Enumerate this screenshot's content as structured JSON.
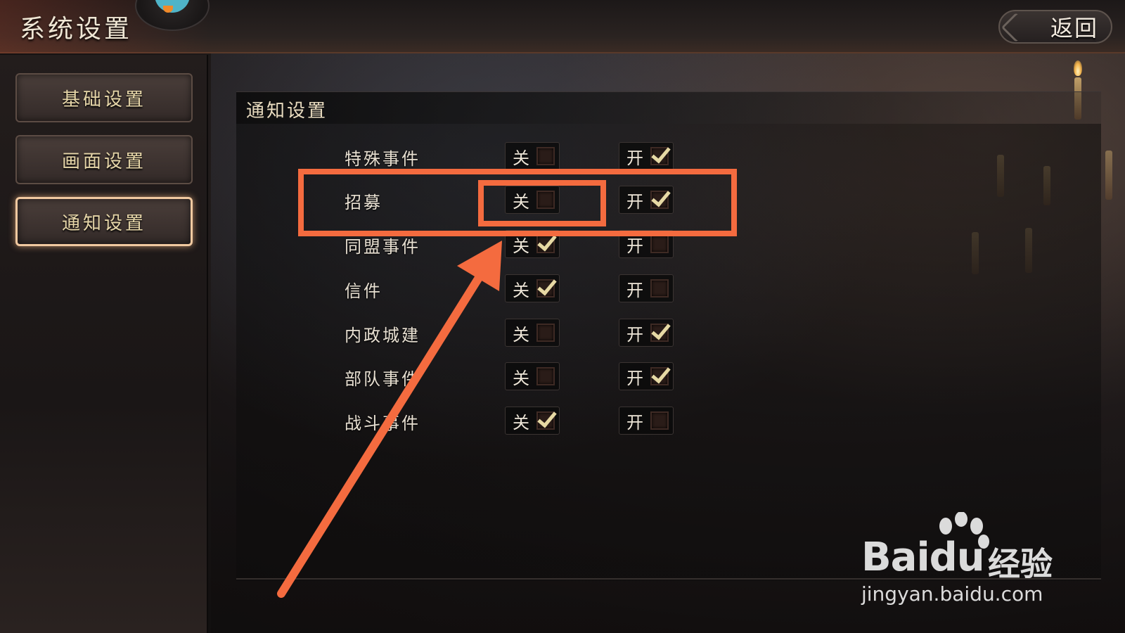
{
  "header": {
    "title": "系统设置",
    "back_label": "返回"
  },
  "sidebar": {
    "items": [
      {
        "label": "基础设置",
        "active": false
      },
      {
        "label": "画面设置",
        "active": false
      },
      {
        "label": "通知设置",
        "active": true
      }
    ]
  },
  "panel": {
    "title": "通知设置",
    "off_label": "关",
    "on_label": "开",
    "rows": [
      {
        "label": "特殊事件",
        "off_checked": false,
        "on_checked": true
      },
      {
        "label": "招募",
        "off_checked": false,
        "on_checked": true
      },
      {
        "label": "同盟事件",
        "off_checked": true,
        "on_checked": false
      },
      {
        "label": "信件",
        "off_checked": true,
        "on_checked": false
      },
      {
        "label": "内政城建",
        "off_checked": false,
        "on_checked": true
      },
      {
        "label": "部队事件",
        "off_checked": false,
        "on_checked": true
      },
      {
        "label": "战斗事件",
        "off_checked": true,
        "on_checked": false
      }
    ]
  },
  "annotation": {
    "color": "#f46b3f"
  },
  "watermark": {
    "logo_text": "Bai",
    "logo_du": "du",
    "brand": "经验",
    "url": "jingyan.baidu.com"
  }
}
